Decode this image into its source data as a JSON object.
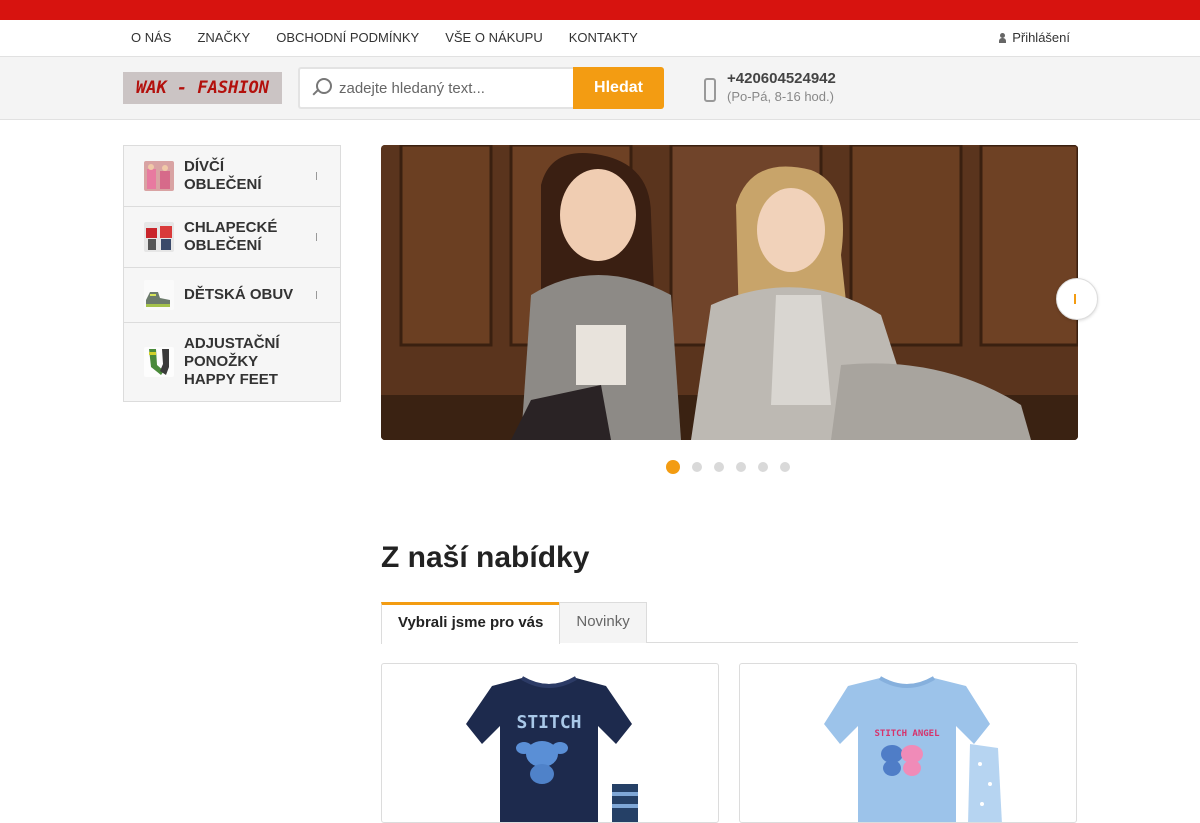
{
  "nav": {
    "items": [
      "O NÁS",
      "ZNAČKY",
      "OBCHODNÍ PODMÍNKY",
      "VŠE O NÁKUPU",
      "KONTAKTY"
    ],
    "login": "Přihlášení"
  },
  "header": {
    "logo": "WAK - FASHION",
    "search_placeholder": "zadejte hledaný text...",
    "search_button": "Hledat",
    "phone": "+420604524942",
    "phone_hours": "(Po-Pá, 8-16 hod.)"
  },
  "sidebar": {
    "categories": [
      {
        "label": "DÍVČÍ OBLEČENÍ",
        "icon": "girls-clothing-thumb"
      },
      {
        "label": "CHLAPECKÉ OBLEČENÍ",
        "icon": "boys-clothing-thumb"
      },
      {
        "label": "DĚTSKÁ OBUV",
        "icon": "kids-shoes-thumb"
      },
      {
        "label": "ADJUSTAČNÍ PONOŽKY HAPPY FEET",
        "icon": "socks-thumb"
      }
    ]
  },
  "slider": {
    "slide_count": 6,
    "active_index": 0
  },
  "offer": {
    "title": "Z naší nabídky",
    "tabs": [
      "Vybrali jsme pro vás",
      "Novinky"
    ],
    "active_tab": 0,
    "products": [
      {
        "print": "STITCH",
        "color": "#1d2a4d"
      },
      {
        "print": "STITCH ANGEL",
        "color": "#9cc3ea"
      }
    ]
  },
  "colors": {
    "brand_red": "#d7130f",
    "accent_orange": "#f39c12"
  }
}
